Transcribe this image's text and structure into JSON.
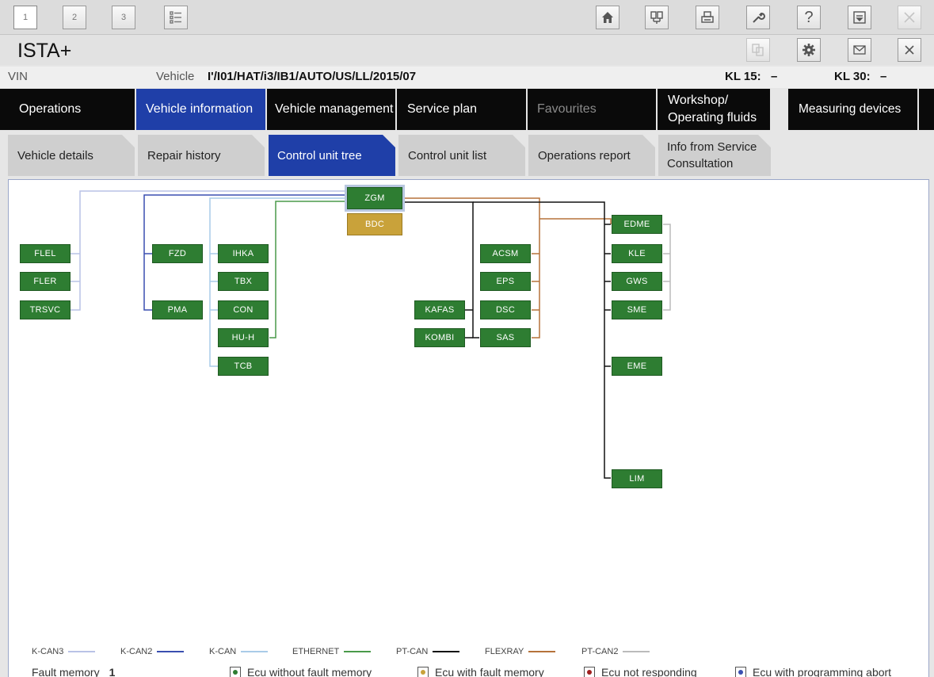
{
  "app_title": "ISTA+",
  "toolbar": {
    "tabs": [
      "1",
      "2",
      "3"
    ]
  },
  "vehicle_bar": {
    "vin_label": "VIN",
    "vin_value": "",
    "vehicle_label": "Vehicle",
    "vehicle_value": "I'/I01/HAT/i3/IB1/AUTO/US/LL/2015/07",
    "kl15_label": "KL 15:",
    "kl15_value": "–",
    "kl30_label": "KL 30:",
    "kl30_value": "–"
  },
  "main_nav": [
    {
      "label": "Operations"
    },
    {
      "label": "Vehicle information",
      "active": true
    },
    {
      "label": "Vehicle management"
    },
    {
      "label": "Service plan"
    },
    {
      "label": "Favourites",
      "disabled": true
    },
    {
      "label": "Workshop/ Operating fluids"
    },
    {
      "label": "Measuring devices"
    }
  ],
  "sub_tabs": [
    {
      "label": "Vehicle details"
    },
    {
      "label": "Repair history"
    },
    {
      "label": "Control unit tree",
      "active": true
    },
    {
      "label": "Control unit list"
    },
    {
      "label": "Operations report"
    },
    {
      "label": "Info from Service Consultation"
    }
  ],
  "ecus": {
    "ZGM": "ZGM",
    "BDC": "BDC",
    "FLEL": "FLEL",
    "FLER": "FLER",
    "TRSVC": "TRSVC",
    "FZD": "FZD",
    "PMA": "PMA",
    "IHKA": "IHKA",
    "TBX": "TBX",
    "CON": "CON",
    "HUH": "HU-H",
    "TCB": "TCB",
    "KAFAS": "KAFAS",
    "KOMBI": "KOMBI",
    "ACSM": "ACSM",
    "EPS": "EPS",
    "DSC": "DSC",
    "SAS": "SAS",
    "EDME": "EDME",
    "KLE": "KLE",
    "GWS": "GWS",
    "SME": "SME",
    "EME": "EME",
    "LIM": "LIM"
  },
  "bus_colors": {
    "K-CAN3": "#b9c2e6",
    "K-CAN2": "#3a4fb0",
    "K-CAN": "#a9cbe8",
    "ETHERNET": "#4a9a4a",
    "PT-CAN": "#111111",
    "FLEXRAY": "#b5723a",
    "PT-CAN2": "#bbbbbb"
  },
  "legend": [
    "K-CAN3",
    "K-CAN2",
    "K-CAN",
    "ETHERNET",
    "PT-CAN",
    "FLEXRAY",
    "PT-CAN2"
  ],
  "status": {
    "fault_memory_label": "Fault memory",
    "fault_memory_value": "1",
    "items": [
      {
        "label": "Ecu without fault memory",
        "color": "#2e7d32"
      },
      {
        "label": "Ecu with fault memory",
        "color": "#c9a23a"
      },
      {
        "label": "Ecu not responding",
        "color": "#a02020"
      },
      {
        "label": "Ecu with programming abort",
        "color": "#3a4fb0"
      }
    ]
  }
}
